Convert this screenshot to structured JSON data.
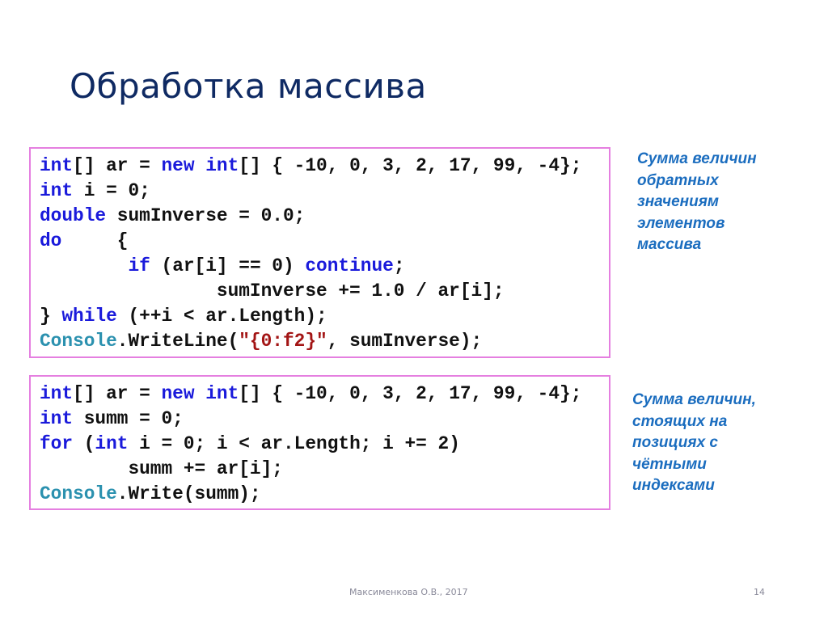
{
  "slide": {
    "title": "Обработка массива",
    "footer": "Максименкова О.В., 2017",
    "page_number": "14"
  },
  "colors": {
    "title": "#0f2a63",
    "keyword": "#1a1adb",
    "class": "#2b91af",
    "string": "#a31515",
    "note": "#1b6dbf",
    "box_border": "#e57fe0"
  },
  "code_blocks": [
    {
      "lines": [
        [
          {
            "t": "kw",
            "s": "int"
          },
          {
            "t": "",
            "s": "[] ar = "
          },
          {
            "t": "kw",
            "s": "new"
          },
          {
            "t": "",
            "s": " "
          },
          {
            "t": "kw",
            "s": "int"
          },
          {
            "t": "",
            "s": "[] { -10, 0, 3, 2, 17, 99, -4};"
          }
        ],
        [
          {
            "t": "kw",
            "s": "int"
          },
          {
            "t": "",
            "s": " i = 0;"
          }
        ],
        [
          {
            "t": "kw",
            "s": "double"
          },
          {
            "t": "",
            "s": " sumInverse = 0.0;"
          }
        ],
        [
          {
            "t": "kw",
            "s": "do"
          },
          {
            "t": "",
            "s": "     {"
          }
        ],
        [
          {
            "t": "",
            "s": "        "
          },
          {
            "t": "kw",
            "s": "if"
          },
          {
            "t": "",
            "s": " (ar[i] == 0) "
          },
          {
            "t": "kw",
            "s": "continue"
          },
          {
            "t": "",
            "s": ";"
          }
        ],
        [
          {
            "t": "",
            "s": "                sumInverse += 1.0 / ar[i];"
          }
        ],
        [
          {
            "t": "",
            "s": "} "
          },
          {
            "t": "kw",
            "s": "while"
          },
          {
            "t": "",
            "s": " (++i < ar.Length);"
          }
        ],
        [
          {
            "t": "cls",
            "s": "Console"
          },
          {
            "t": "",
            "s": ".WriteLine("
          },
          {
            "t": "str",
            "s": "\"{0:f2}\""
          },
          {
            "t": "",
            "s": ", sumInverse);"
          }
        ]
      ],
      "note": [
        "Сумма величин",
        "обратных",
        "значениям",
        "элементов",
        "массива"
      ]
    },
    {
      "lines": [
        [
          {
            "t": "kw",
            "s": "int"
          },
          {
            "t": "",
            "s": "[] ar = "
          },
          {
            "t": "kw",
            "s": "new"
          },
          {
            "t": "",
            "s": " "
          },
          {
            "t": "kw",
            "s": "int"
          },
          {
            "t": "",
            "s": "[] { -10, 0, 3, 2, 17, 99, -4};"
          }
        ],
        [
          {
            "t": "kw",
            "s": "int"
          },
          {
            "t": "",
            "s": " summ = 0;"
          }
        ],
        [
          {
            "t": "kw",
            "s": "for"
          },
          {
            "t": "",
            "s": " ("
          },
          {
            "t": "kw",
            "s": "int"
          },
          {
            "t": "",
            "s": " i = 0; i < ar.Length; i += 2)"
          }
        ],
        [
          {
            "t": "",
            "s": "        summ += ar[i];"
          }
        ],
        [
          {
            "t": "cls",
            "s": "Console"
          },
          {
            "t": "",
            "s": ".Write(summ);"
          }
        ]
      ],
      "note": [
        "Сумма величин,",
        "стоящих на",
        "позициях с",
        "чётными",
        "индексами"
      ]
    }
  ]
}
